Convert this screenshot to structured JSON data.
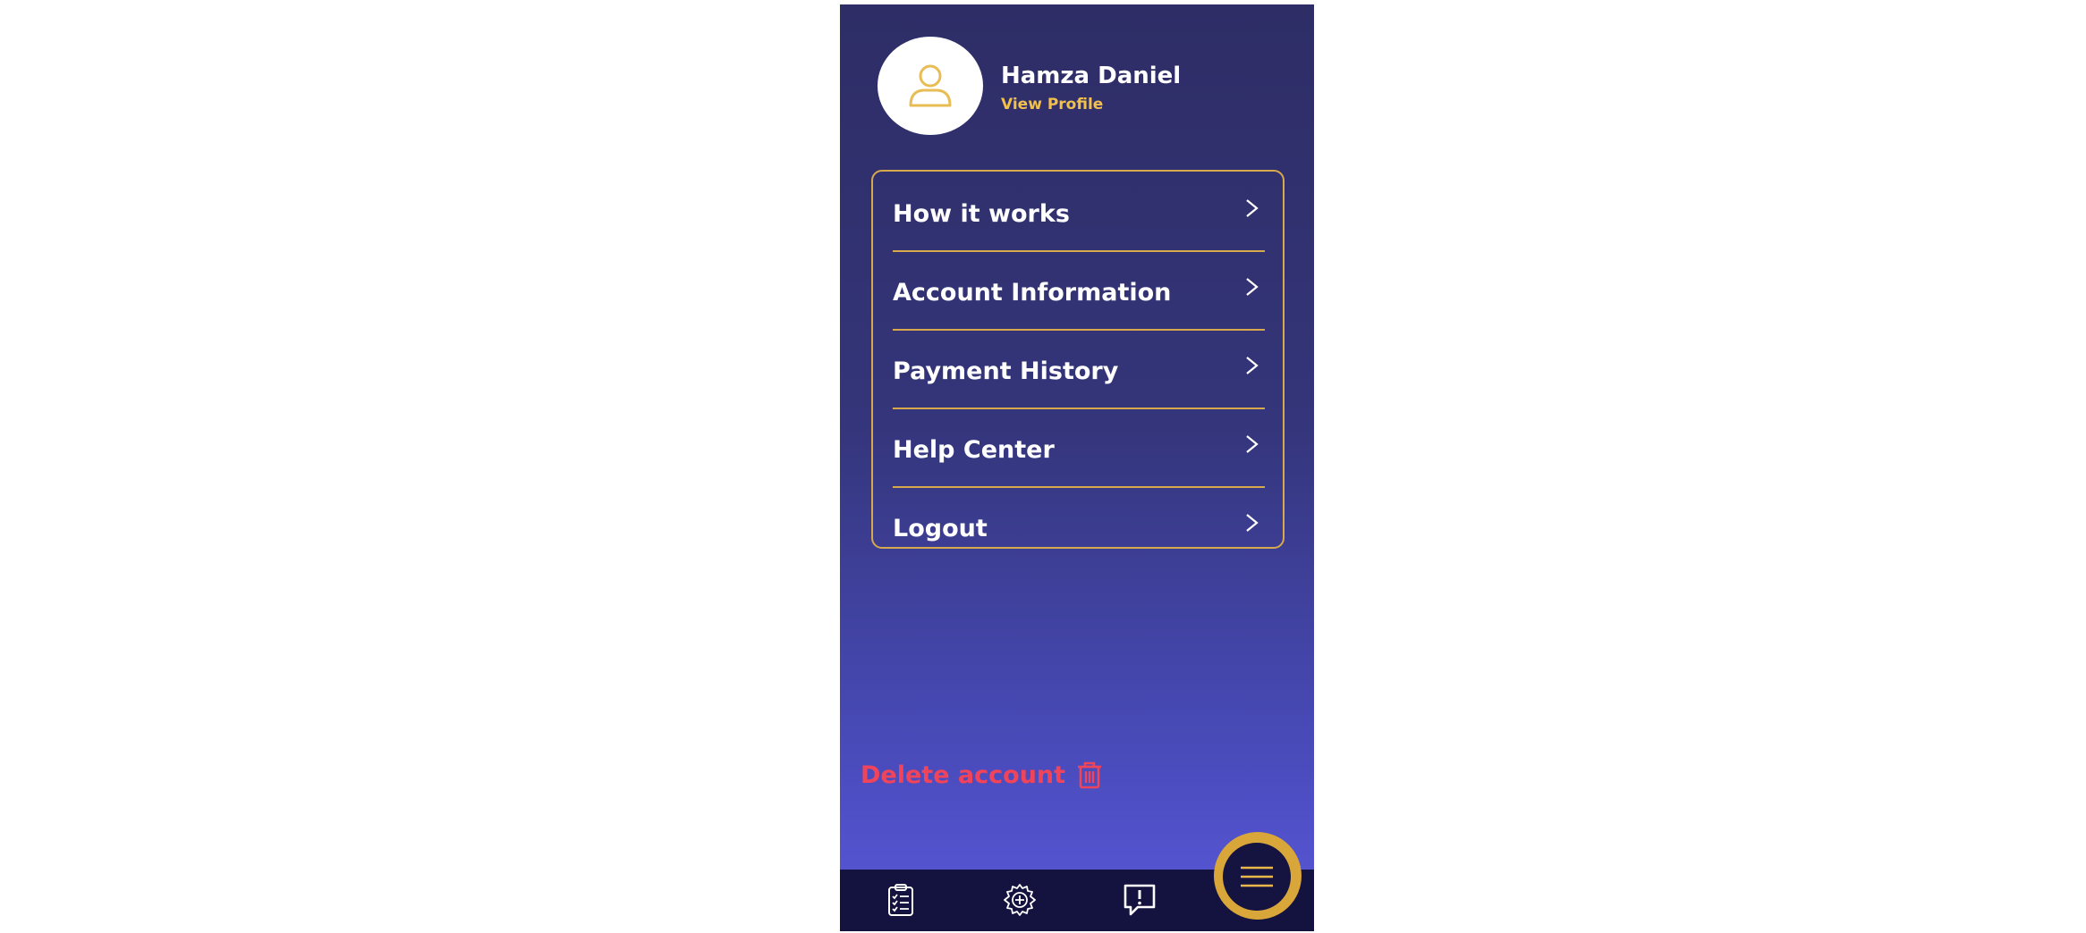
{
  "profile": {
    "name": "Hamza Daniel",
    "view_profile_label": "View Profile"
  },
  "menu": {
    "items": [
      {
        "label": "How it works"
      },
      {
        "label": "Account Information"
      },
      {
        "label": "Payment History"
      },
      {
        "label": "Help Center"
      },
      {
        "label": "Logout"
      }
    ]
  },
  "delete_account_label": "Delete account",
  "bottom_nav": {
    "icons": [
      "clipboard-checklist-icon",
      "settings-gear-plus-icon",
      "feedback-alert-icon",
      "menu-hamburger-icon"
    ]
  },
  "colors": {
    "background_top": "#2e2d66",
    "background_bottom": "#5a58da",
    "accent_gold": "#d7a94c",
    "danger_red": "#f0445a",
    "nav_bg": "#14123e"
  }
}
